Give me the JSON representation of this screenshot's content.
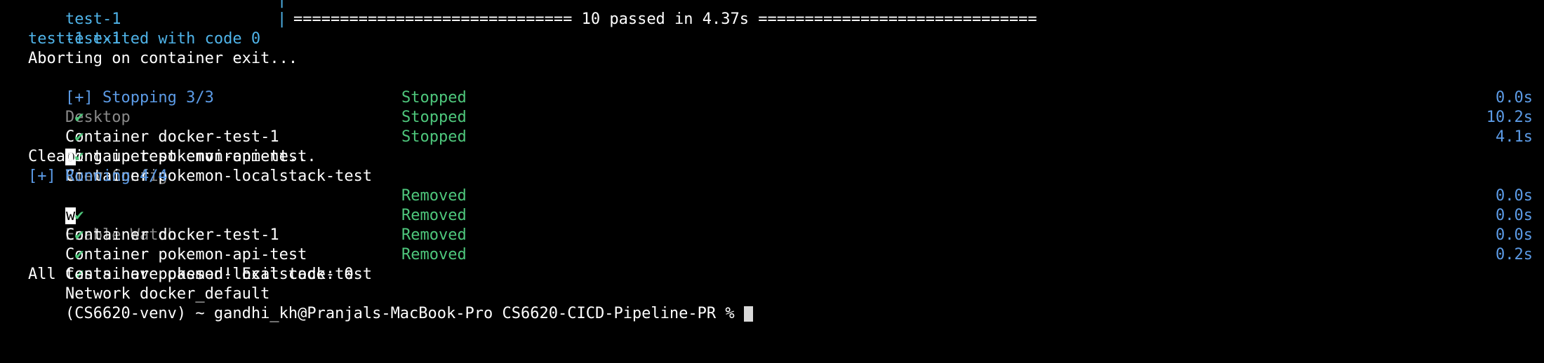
{
  "terminal": {
    "line0": {
      "prefix": "test-1",
      "sep": "|"
    },
    "line1": {
      "prefix": "test-1",
      "sep": "|",
      "summary": "============================== 10 passed in 4.37s =============================="
    },
    "line2": {
      "text": "test-1 exited with code 0"
    },
    "line3": {
      "text": "Aborting on container exit..."
    },
    "line4": {
      "text": "[+] Stopping 3/3",
      "desktop": "Desktop",
      "key1": "o",
      "action1": "View Config",
      "key2": "w",
      "action2": "Enable Watch"
    },
    "stopped": [
      {
        "check": "✔",
        "label": "Container docker-test-1",
        "status": "Stopped",
        "time": "0.0s"
      },
      {
        "check": "✔",
        "label": "Container pokemon-api-test",
        "status": "Stopped",
        "time": "10.2s"
      },
      {
        "check": "✔",
        "label": "Container pokemon-localstack-test",
        "status": "Stopped",
        "time": "4.1s"
      }
    ],
    "cleanup": {
      "text": "Cleaning up test environment..."
    },
    "running": {
      "text": "[+] Running 4/4"
    },
    "removed": [
      {
        "check": "✔",
        "label": "Container docker-test-1",
        "status": "Removed",
        "time": "0.0s"
      },
      {
        "check": "✔",
        "label": "Container pokemon-api-test",
        "status": "Removed",
        "time": "0.0s"
      },
      {
        "check": "✔",
        "label": "Container pokemon-localstack-test",
        "status": "Removed",
        "time": "0.0s"
      },
      {
        "check": "✔",
        "label": "Network docker_default",
        "status": "Removed",
        "time": "0.2s"
      }
    ],
    "final": {
      "text": "All tests have passed! Exit code: 0"
    },
    "prompt": {
      "text": "(CS6620-venv) ~ gandhi_kh@Pranjals-MacBook-Pro CS6620-CICD-Pipeline-PR % "
    }
  }
}
